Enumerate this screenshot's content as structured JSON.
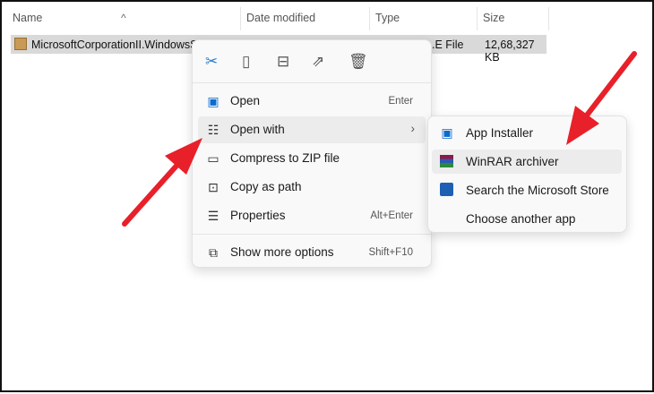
{
  "columns": {
    "name": "Name",
    "date": "Date modified",
    "type": "Type",
    "size": "Size"
  },
  "file": {
    "name": "MicrosoftCorporationII.WindowsS",
    "type": ".E File",
    "size": "12,68,327 KB"
  },
  "context_menu": {
    "toolbar": [
      "cut-icon",
      "copy-icon",
      "rename-icon",
      "share-icon",
      "delete-icon"
    ],
    "items": [
      {
        "label": "Open",
        "shortcut": "Enter",
        "icon": "app-installer-icon"
      },
      {
        "label": "Open with",
        "shortcut": "",
        "icon": "open-with-icon"
      },
      {
        "label": "Compress to ZIP file",
        "shortcut": "",
        "icon": "zip-folder-icon"
      },
      {
        "label": "Copy as path",
        "shortcut": "",
        "icon": "copy-path-icon"
      },
      {
        "label": "Properties",
        "shortcut": "Alt+Enter",
        "icon": "properties-icon"
      },
      {
        "label": "Show more options",
        "shortcut": "Shift+F10",
        "icon": "show-more-icon"
      }
    ]
  },
  "submenu": {
    "items": [
      {
        "label": "App Installer",
        "icon": "app-installer-icon"
      },
      {
        "label": "WinRAR archiver",
        "icon": "winrar-icon"
      },
      {
        "label": "Search the Microsoft Store",
        "icon": "microsoft-store-icon"
      },
      {
        "label": "Choose another app"
      }
    ]
  },
  "colors": {
    "arrow": "#e8202a",
    "accent": "#0a6ccf"
  }
}
